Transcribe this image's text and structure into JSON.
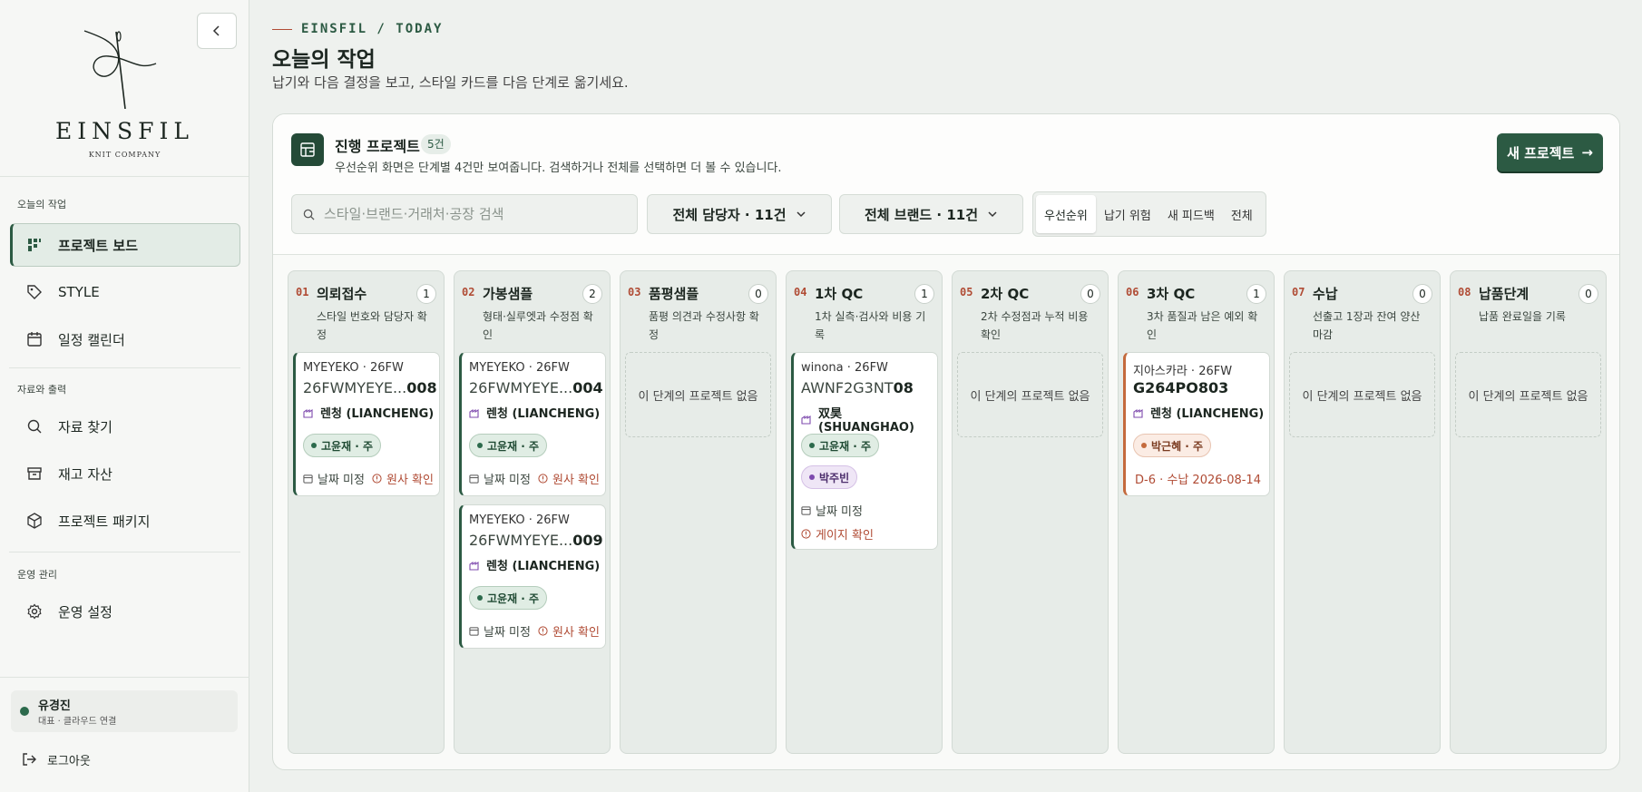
{
  "sidebar": {
    "logo_word": "EINSFIL",
    "logo_sub": "KNIT COMPANY",
    "sections": [
      {
        "label": "오늘의 작업",
        "items": [
          {
            "label": "프로젝트 보드",
            "icon": "board-icon",
            "active": true
          },
          {
            "label": "STYLE",
            "icon": "tag-icon"
          },
          {
            "label": "일정 캘린더",
            "icon": "calendar-icon"
          }
        ]
      },
      {
        "label": "자료와 출력",
        "items": [
          {
            "label": "자료 찾기",
            "icon": "search-icon"
          },
          {
            "label": "재고 자산",
            "icon": "archive-icon"
          },
          {
            "label": "프로젝트 패키지",
            "icon": "package-icon"
          }
        ]
      },
      {
        "label": "운영 관리",
        "items": [
          {
            "label": "운영 설정",
            "icon": "gear-icon"
          }
        ]
      }
    ],
    "user": {
      "name": "유경진",
      "role": "대표 · 클라우드 연결"
    },
    "logout_label": "로그아웃"
  },
  "header": {
    "eyebrow": "EINSFIL / TODAY",
    "title": "오늘의 작업",
    "subtitle": "납기와 다음 결정을 보고, 스타일 카드를 다음 단계로 옮기세요."
  },
  "board": {
    "title": "진행 프로젝트",
    "count": "5건",
    "description": "우선순위 화면은 단계별 4건만 보여줍니다. 검색하거나 전체를 선택하면 더 볼 수 있습니다.",
    "new_button": "새 프로젝트",
    "search_placeholder": "스타일·브랜드·거래처·공장 검색",
    "filter_owner": "전체 담당자 · 11건",
    "filter_brand": "전체 브랜드 · 11건",
    "tabs": [
      "우선순위",
      "납기 위험",
      "새 피드백",
      "전체"
    ],
    "active_tab": "우선순위",
    "colors": {
      "accent": "#2c5a43",
      "warning": "#b04b34",
      "warn_border": "#c46a3d"
    }
  },
  "empty_label": "이 단계의 프로젝트 없음",
  "columns": [
    {
      "num": "01",
      "title": "의뢰접수",
      "count": "1",
      "desc": "스타일 번호와 담당자 확정",
      "cards": [
        {
          "brand": "MYEYEKO · 26FW",
          "style_prefix": "26FWMYEYE...",
          "style_suffix": "008",
          "factory": "렌청 (LIANCHENG)",
          "chips": [
            {
              "label": "고윤재 · 주",
              "color": "green"
            }
          ],
          "date": "날짜 미정",
          "warn": "원사 확인"
        }
      ]
    },
    {
      "num": "02",
      "title": "가봉샘플",
      "count": "2",
      "desc": "형태·실루엣과 수정점 확인",
      "cards": [
        {
          "brand": "MYEYEKO · 26FW",
          "style_prefix": "26FWMYEYE...",
          "style_suffix": "004",
          "factory": "렌청 (LIANCHENG)",
          "chips": [
            {
              "label": "고윤재 · 주",
              "color": "green"
            }
          ],
          "date": "날짜 미정",
          "warn": "원사 확인"
        },
        {
          "brand": "MYEYEKO · 26FW",
          "style_prefix": "26FWMYEYE...",
          "style_suffix": "009",
          "factory": "렌청 (LIANCHENG)",
          "chips": [
            {
              "label": "고윤재 · 주",
              "color": "green"
            }
          ],
          "date": "날짜 미정",
          "warn": "원사 확인"
        }
      ]
    },
    {
      "num": "03",
      "title": "품평샘플",
      "count": "0",
      "desc": "품평 의견과 수정사항 확정",
      "cards": []
    },
    {
      "num": "04",
      "title": "1차 QC",
      "count": "1",
      "desc": "1차 실측·검사와 비용 기록",
      "cards": [
        {
          "brand": "winona · 26FW",
          "style_prefix": "AWNF2G3NT",
          "style_suffix": "08",
          "factory": "双昊 (SHUANGHAO)",
          "chips": [
            {
              "label": "고윤재 · 주",
              "color": "green"
            },
            {
              "label": "박주빈",
              "color": "purple"
            }
          ],
          "date": "날짜 미정",
          "warn": "게이지 확인",
          "stacked": true
        }
      ]
    },
    {
      "num": "05",
      "title": "2차 QC",
      "count": "0",
      "desc": "2차 수정점과 누적 비용 확인",
      "cards": []
    },
    {
      "num": "06",
      "title": "3차 QC",
      "count": "1",
      "desc": "3차 품질과 남은 예외 확인",
      "cards": [
        {
          "brand": "지아스카라 · 26FW",
          "style_prefix": "",
          "style_suffix": "G264PO803",
          "factory": "렌청 (LIANCHENG)",
          "chips": [
            {
              "label": "박근혜 · 주",
              "color": "orange"
            }
          ],
          "deadline": "D-6 · 수납 2026-08-14",
          "warn_card": true
        }
      ]
    },
    {
      "num": "07",
      "title": "수납",
      "count": "0",
      "desc": "선출고 1장과 잔여 양산 마감",
      "cards": []
    },
    {
      "num": "08",
      "title": "납품단계",
      "count": "0",
      "desc": "납품 완료일을 기록",
      "cards": []
    }
  ]
}
